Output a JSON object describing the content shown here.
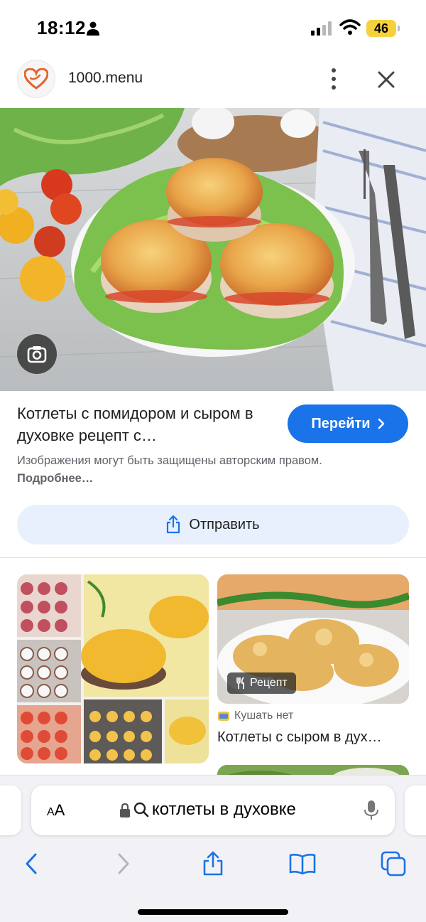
{
  "status_bar": {
    "time": "18:12",
    "battery": "46"
  },
  "source": {
    "site_name": "1000.menu"
  },
  "result": {
    "title": "Котлеты с помидором и сыром в духовке рецепт с…",
    "visit_label": "Перейти",
    "copyright_text": "Изображения могут быть защищены авторским правом.",
    "more_label": "Подробнее…",
    "share_label": "Отправить"
  },
  "related": {
    "badge_label": "Рецепт",
    "source_name": "Кушать нет",
    "title": "Котлеты с сыром в дух…"
  },
  "browser": {
    "aa_label_small": "A",
    "aa_label_big": "A",
    "query": "котлеты в духовке"
  },
  "colors": {
    "accent": "#1a73e8",
    "share_bg": "#e8f0fe",
    "battery": "#f5d23c"
  }
}
